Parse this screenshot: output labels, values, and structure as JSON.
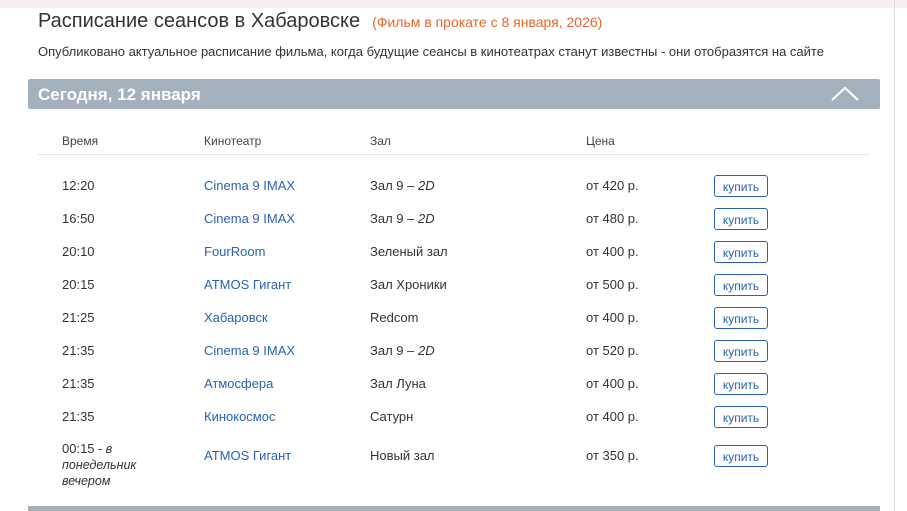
{
  "page": {
    "title": "Расписание сеансов в Хабаровске",
    "subtitle": "(Фильм в прокате с 8 января, 2026)",
    "lead": "Опубликовано актуальное расписание фильма, когда будущие сеансы в кинотеатрах станут известны - они отобразятся на сайте"
  },
  "day": {
    "label": "Сегодня, 12 января",
    "collapse_icon": "chevron-up-icon"
  },
  "table": {
    "headers": {
      "time": "Время",
      "cinema": "Кинотеатр",
      "hall": "Зал",
      "price": "Цена"
    },
    "buy_label": "купить",
    "rows": [
      {
        "time": "12:20",
        "cinema": "Cinema 9 IMAX",
        "hall": "Зал 9",
        "format": " – 2D",
        "price": "от 420 р."
      },
      {
        "time": "16:50",
        "cinema": "Cinema 9 IMAX",
        "hall": "Зал 9",
        "format": " – 2D",
        "price": "от 480 р."
      },
      {
        "time": "20:10",
        "cinema": "FourRoom",
        "hall": "Зеленый зал",
        "format": "",
        "price": "от 400 р."
      },
      {
        "time": "20:15",
        "cinema": "ATMOS Гигант",
        "hall": "Зал Хроники",
        "format": "",
        "price": "от 500 р."
      },
      {
        "time": "21:25",
        "cinema": "Хабаровск",
        "hall": "Redcom",
        "format": "",
        "price": "от 400 р."
      },
      {
        "time": "21:35",
        "cinema": "Cinema 9 IMAX",
        "hall": "Зал 9",
        "format": " – 2D",
        "price": "от 520 р."
      },
      {
        "time": "21:35",
        "cinema": "Атмосфера",
        "hall": "Зал Луна",
        "format": "",
        "price": "от 400 р."
      },
      {
        "time": "21:35",
        "cinema": "Кинокосмос",
        "hall": "Сатурн",
        "format": "",
        "price": "от 400 р."
      },
      {
        "time": "00:15",
        "time_note": " - в понедельник вечером",
        "cinema": "ATMOS Гигант",
        "hall": "Новый зал",
        "format": "",
        "price": "от 350 р."
      }
    ]
  }
}
